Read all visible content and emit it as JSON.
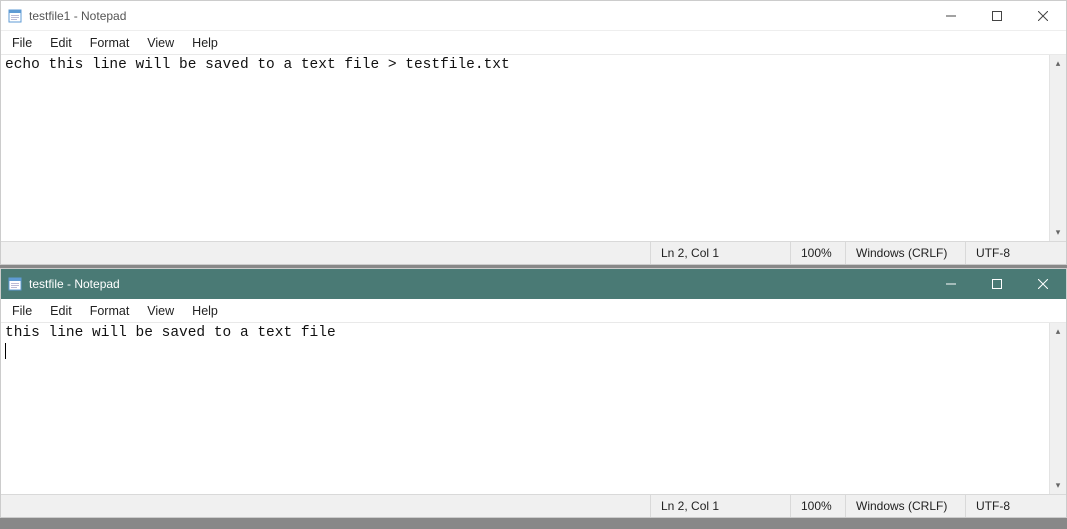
{
  "windows": [
    {
      "title": "testfile1 - Notepad",
      "active": false,
      "menu": [
        "File",
        "Edit",
        "Format",
        "View",
        "Help"
      ],
      "content": "echo this line will be saved to a text file > testfile.txt",
      "status": {
        "pos": "Ln 2, Col 1",
        "zoom": "100%",
        "eol": "Windows (CRLF)",
        "enc": "UTF-8"
      }
    },
    {
      "title": "testfile - Notepad",
      "active": true,
      "menu": [
        "File",
        "Edit",
        "Format",
        "View",
        "Help"
      ],
      "content": "this line will be saved to a text file ",
      "status": {
        "pos": "Ln 2, Col 1",
        "zoom": "100%",
        "eol": "Windows (CRLF)",
        "enc": "UTF-8"
      }
    }
  ]
}
